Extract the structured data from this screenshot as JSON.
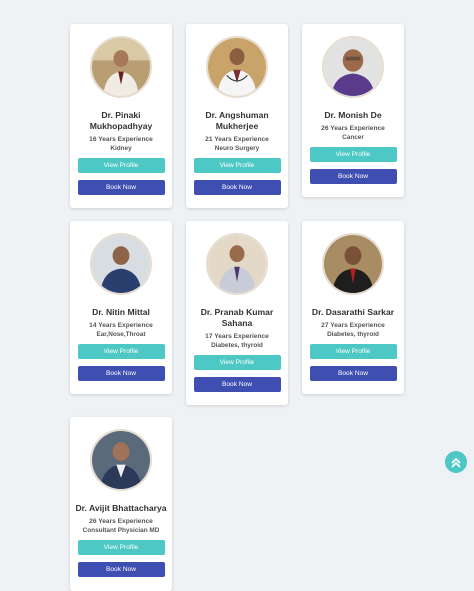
{
  "doctors": [
    {
      "name_line1": "Dr. Pinaki",
      "name_line2": "Mukhopadhyay",
      "experience": "16 Years Experience",
      "specialty": "Kidney",
      "profile_label": "View Profile",
      "book_label": "Book Now"
    },
    {
      "name_line1": "Dr. Angshuman",
      "name_line2": "Mukherjee",
      "experience": "21 Years Experience",
      "specialty": "Neuro Surgery",
      "profile_label": "View Profile",
      "book_label": "Book Now"
    },
    {
      "name_line1": "Dr. Monish De",
      "name_line2": "",
      "experience": "26 Years Experience",
      "specialty": "Cancer",
      "profile_label": "View Profile",
      "book_label": "Book Now"
    },
    {
      "name_line1": "Dr. Nitin Mittal",
      "name_line2": "",
      "experience": "14 Years Experience",
      "specialty": "Ear,Nose,Throat",
      "profile_label": "View Profile",
      "book_label": "Book Now"
    },
    {
      "name_line1": "Dr. Pranab Kumar",
      "name_line2": "Sahana",
      "experience": "17 Years Experience",
      "specialty": "Diabetes, thyroid",
      "profile_label": "View Profile",
      "book_label": "Book Now"
    },
    {
      "name_line1": "Dr. Dasarathi Sarkar",
      "name_line2": "",
      "experience": "27 Years Experience",
      "specialty": "Diabetes, thyroid",
      "profile_label": "View Profile",
      "book_label": "Book Now"
    },
    {
      "name_line1": "Dr. Avijit Bhattacharya",
      "name_line2": "",
      "experience": "26 Years Experience",
      "specialty": "Consultant Physician MD",
      "profile_label": "View Profile",
      "book_label": "Book Now"
    }
  ],
  "icons": {
    "scroll_top": "double-chevron-up-icon"
  },
  "colors": {
    "view_profile": "#4ec8c4",
    "book_now": "#3e4fb1",
    "background": "#eef2f5"
  }
}
